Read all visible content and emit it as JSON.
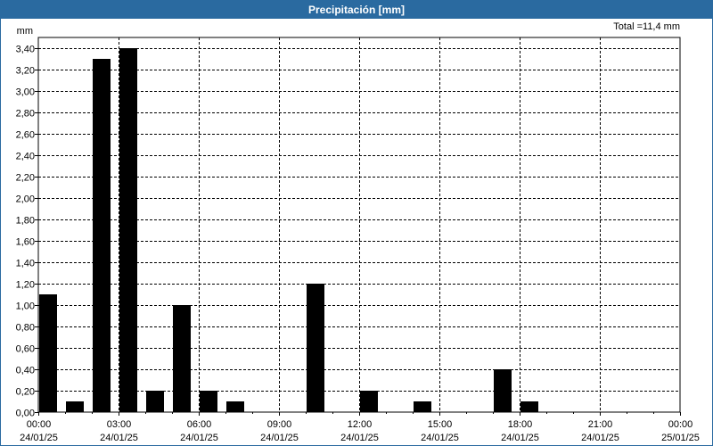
{
  "window": {
    "title": "Precipitación [mm]"
  },
  "chart_data": {
    "type": "bar",
    "title": "Precipitación [mm]",
    "ylabel": "mm",
    "total_label": "Total =11,4 mm",
    "ylim": [
      0,
      3.5
    ],
    "y_ticks": [
      "0,00",
      "0,20",
      "0,40",
      "0,60",
      "0,80",
      "1,00",
      "1,20",
      "1,40",
      "1,60",
      "1,80",
      "2,00",
      "2,20",
      "2,40",
      "2,60",
      "2,80",
      "3,00",
      "3,20",
      "3,40"
    ],
    "x_ticks": [
      {
        "time": "00:00",
        "date": "24/01/25"
      },
      {
        "time": "03:00",
        "date": "24/01/25"
      },
      {
        "time": "06:00",
        "date": "24/01/25"
      },
      {
        "time": "09:00",
        "date": "24/01/25"
      },
      {
        "time": "12:00",
        "date": "24/01/25"
      },
      {
        "time": "15:00",
        "date": "24/01/25"
      },
      {
        "time": "18:00",
        "date": "24/01/25"
      },
      {
        "time": "21:00",
        "date": "24/01/25"
      },
      {
        "time": "00:00",
        "date": "25/01/25"
      }
    ],
    "grid": true,
    "bar_color": "#000000",
    "categories": [
      "00:00",
      "01:00",
      "02:00",
      "03:00",
      "04:00",
      "05:00",
      "06:00",
      "07:00",
      "08:00",
      "09:00",
      "10:00",
      "11:00",
      "12:00",
      "13:00",
      "14:00",
      "15:00",
      "16:00",
      "17:00",
      "18:00",
      "19:00",
      "20:00",
      "21:00",
      "22:00",
      "23:00"
    ],
    "values": [
      1.1,
      0.1,
      3.3,
      3.4,
      0.2,
      1.0,
      0.2,
      0.1,
      0,
      0,
      1.2,
      0,
      0.2,
      0,
      0.1,
      0,
      0,
      0.4,
      0.1,
      0,
      0,
      0,
      0,
      0
    ]
  }
}
